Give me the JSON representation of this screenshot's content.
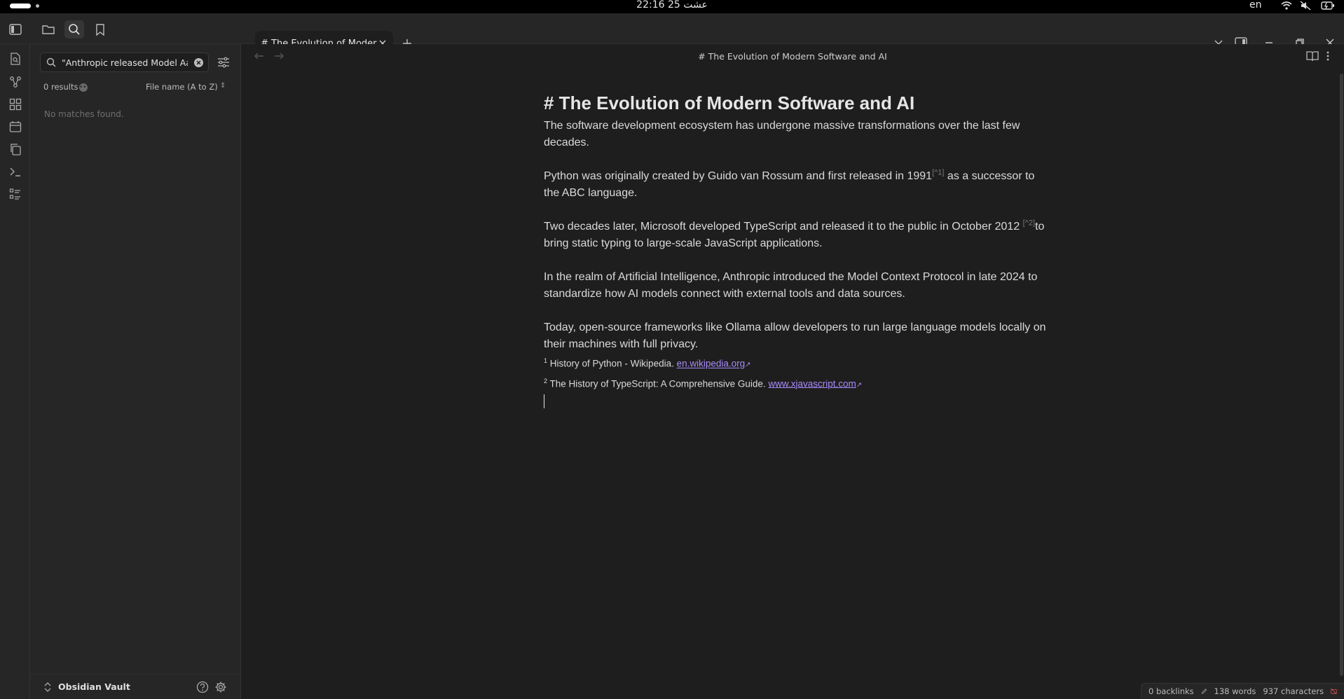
{
  "os_bar": {
    "clock": "22:16  25 عشت",
    "language": "en"
  },
  "tab": {
    "title": "# The Evolution of Moder…"
  },
  "search": {
    "query": "\"Anthropic released Model Aa",
    "results_count": "0 results",
    "sort_label": "File name (A to Z)",
    "empty_message": "No matches found."
  },
  "vault": {
    "name": "Obsidian Vault"
  },
  "view_header": {
    "title": "# The Evolution of Modern Software and AI"
  },
  "document": {
    "heading": "# The Evolution of Modern Software and AI",
    "p1": "The software development ecosystem has undergone massive transformations over the last few decades.",
    "p2_a": "Python was originally created by Guido van Rossum and first released in 1991",
    "p2_ref": "[^1]",
    "p2_b": " as a successor to the ABC language.",
    "p3_a": "Two decades later, Microsoft developed TypeScript and released it to the public in October 2012 ",
    "p3_ref": "[^2]",
    "p3_b": "to bring static typing to large-scale JavaScript applications.",
    "p4": "In the realm of Artificial Intelligence, Anthropic introduced the Model Context Protocol in late 2024 to standardize how AI models connect with external tools and data sources.",
    "p5": "Today, open-source frameworks like Ollama allow developers to run large language models locally on their machines with full privacy.",
    "footnotes": [
      {
        "num": "1",
        "text": "History of Python - Wikipedia. ",
        "link": "en.wikipedia.org"
      },
      {
        "num": "2",
        "text": "The History of TypeScript: A Comprehensive Guide. ",
        "link": "www.xjavascript.com"
      }
    ]
  },
  "status_bar": {
    "backlinks": "0 backlinks",
    "words": "138 words",
    "characters": "937 characters"
  },
  "colors": {
    "accent_link": "#a88bfa",
    "background": "#1e1e1e",
    "panel": "#262626"
  }
}
